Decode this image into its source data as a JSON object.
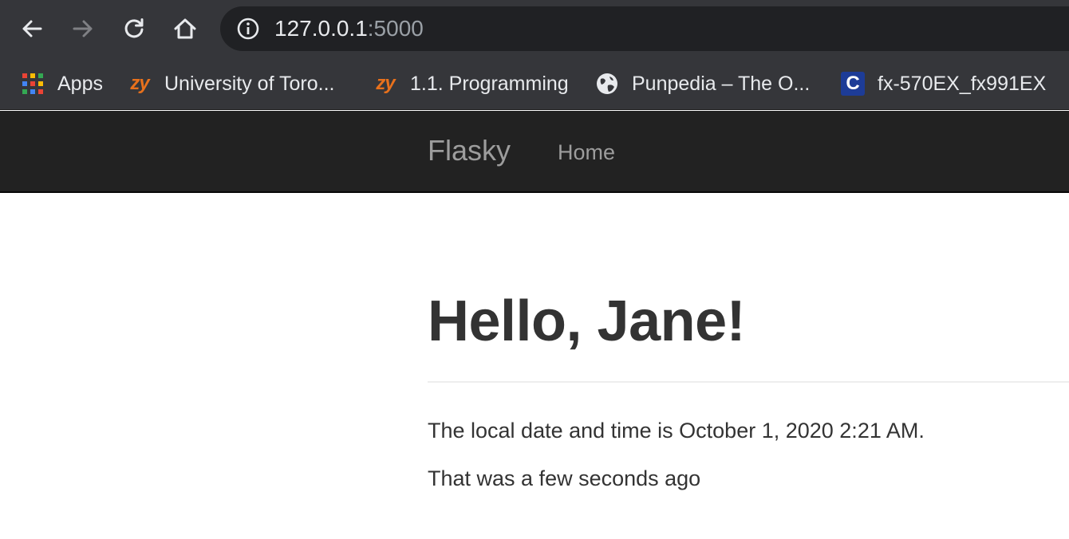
{
  "browser": {
    "url_host": "127.0.0.1",
    "url_port": ":5000",
    "icons": {
      "back": "arrow-left-icon",
      "forward": "arrow-right-icon",
      "reload": "reload-icon",
      "home": "home-icon",
      "site_info": "info-icon"
    },
    "bookmarks": [
      {
        "label": "Apps",
        "icon": "apps-grid-icon"
      },
      {
        "label": "University of Toro...",
        "icon": "zy-icon"
      },
      {
        "label": "1.1. Programming",
        "icon": "zy-icon"
      },
      {
        "label": "Punpedia – The O...",
        "icon": "globe-icon"
      },
      {
        "label": "fx-570EX_fx991EX",
        "icon": "casio-c-icon"
      }
    ],
    "icon_text": {
      "zy": "zy",
      "casio": "C"
    }
  },
  "navbar": {
    "brand": "Flasky",
    "home": "Home"
  },
  "main": {
    "heading": "Hello, Jane!",
    "datetime_text": "The local date and time is October 1, 2020 2:21 AM.",
    "relative_text": "That was a few seconds ago"
  },
  "colors": {
    "chrome_bg": "#35363a",
    "omnibox_bg": "#202124",
    "navbar_bg": "#222222",
    "navbar_text": "#9d9d9d",
    "body_text": "#333333",
    "zy_orange": "#e8711c",
    "casio_blue": "#1d3c97"
  }
}
